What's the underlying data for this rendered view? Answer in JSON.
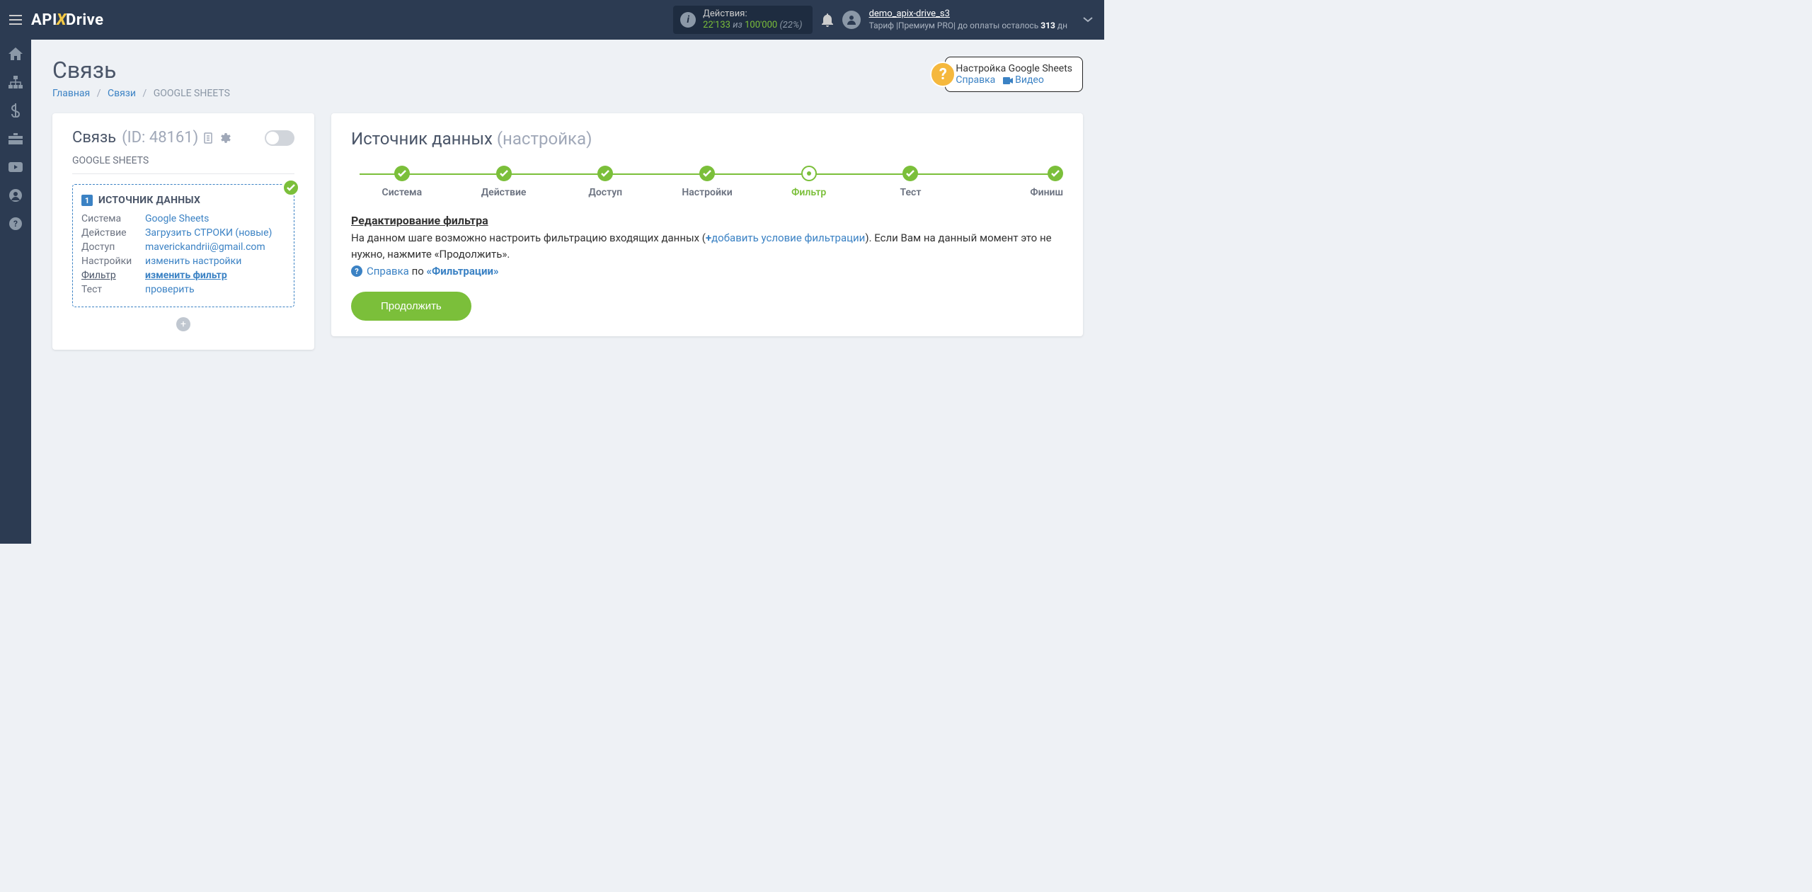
{
  "header": {
    "logo_parts": {
      "api": "API",
      "x": "X",
      "drive": "Drive"
    },
    "actions": {
      "label": "Действия:",
      "count": "22'133",
      "of": "из",
      "total": "100'000",
      "pct": "(22%)"
    },
    "user": {
      "name": "demo_apix-drive_s3",
      "tariff_prefix": "Тариф |Премиум PRO| до оплаты осталось ",
      "days": "313",
      "days_suffix": " дн"
    }
  },
  "page": {
    "title": "Связь",
    "breadcrumbs": {
      "home": "Главная",
      "links": "Связи",
      "current": "GOOGLE SHEETS"
    },
    "help": {
      "title": "Настройка Google Sheets",
      "link1": "Справка",
      "link2": "Видео"
    }
  },
  "left_card": {
    "title": "Связь",
    "id_label": "(ID: 48161)",
    "subtitle": "GOOGLE SHEETS",
    "source_head": "ИСТОЧНИК ДАННЫХ",
    "rows": {
      "r1_label": "Система",
      "r1_value": "Google Sheets",
      "r2_label": "Действие",
      "r2_value": "Загрузить СТРОКИ (новые)",
      "r3_label": "Доступ",
      "r3_value": "maverickandrii@gmail.com",
      "r4_label": "Настройки",
      "r4_value": "изменить настройки",
      "r5_label": "Фильтр",
      "r5_value": "изменить фильтр",
      "r6_label": "Тест",
      "r6_value": "проверить"
    }
  },
  "right_card": {
    "title": "Источник данных",
    "subtitle": "(настройка)",
    "steps": {
      "s1": "Система",
      "s2": "Действие",
      "s3": "Доступ",
      "s4": "Настройки",
      "s5": "Фильтр",
      "s6": "Тест",
      "s7": "Финиш"
    },
    "filter_heading": "Редактирование фильтра",
    "desc": {
      "before": "На данном шаге возможно настроить фильтрацию входящих данных (",
      "plus": "+",
      "link": "добавить условие фильтрации",
      "after": "). Если Вам на данный момент это не нужно, нажмите «Продолжить»."
    },
    "help_link_prefix": "Справка",
    "help_link_middle": " по ",
    "help_link_bold": "«Фильтрации»",
    "continue": "Продолжить"
  }
}
